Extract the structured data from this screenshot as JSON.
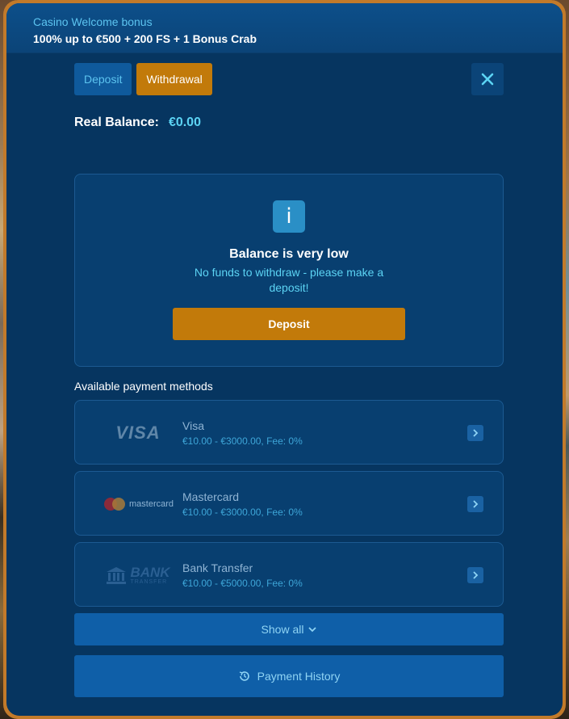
{
  "banner": {
    "subtitle": "Casino Welcome bonus",
    "title": "100% up to €500 + 200 FS + 1 Bonus Crab"
  },
  "tabs": [
    {
      "label": "Deposit",
      "active": false
    },
    {
      "label": "Withdrawal",
      "active": true
    }
  ],
  "close_icon": "close-icon",
  "balance": {
    "label": "Real Balance:",
    "value": "€0.00"
  },
  "info": {
    "icon": "info-icon",
    "title": "Balance is very low",
    "text": "No funds to withdraw - please make a deposit!",
    "button_label": "Deposit"
  },
  "methods_title": "Available payment methods",
  "methods": [
    {
      "name": "Visa",
      "range": "€10.00 - €3000.00, Fee: 0%",
      "logo": "VISA"
    },
    {
      "name": "Mastercard",
      "range": "€10.00 - €3000.00, Fee: 0%",
      "logo": "mastercard"
    },
    {
      "name": "Bank Transfer",
      "range": "€10.00 - €5000.00, Fee: 0%",
      "logo": "BANK",
      "logo_sub": "TRANSFER"
    }
  ],
  "show_all_label": "Show all",
  "history_label": "Payment History",
  "colors": {
    "accent_orange": "#c27a0a",
    "panel_bg": "#063560",
    "link_cyan": "#5cd4f4"
  }
}
